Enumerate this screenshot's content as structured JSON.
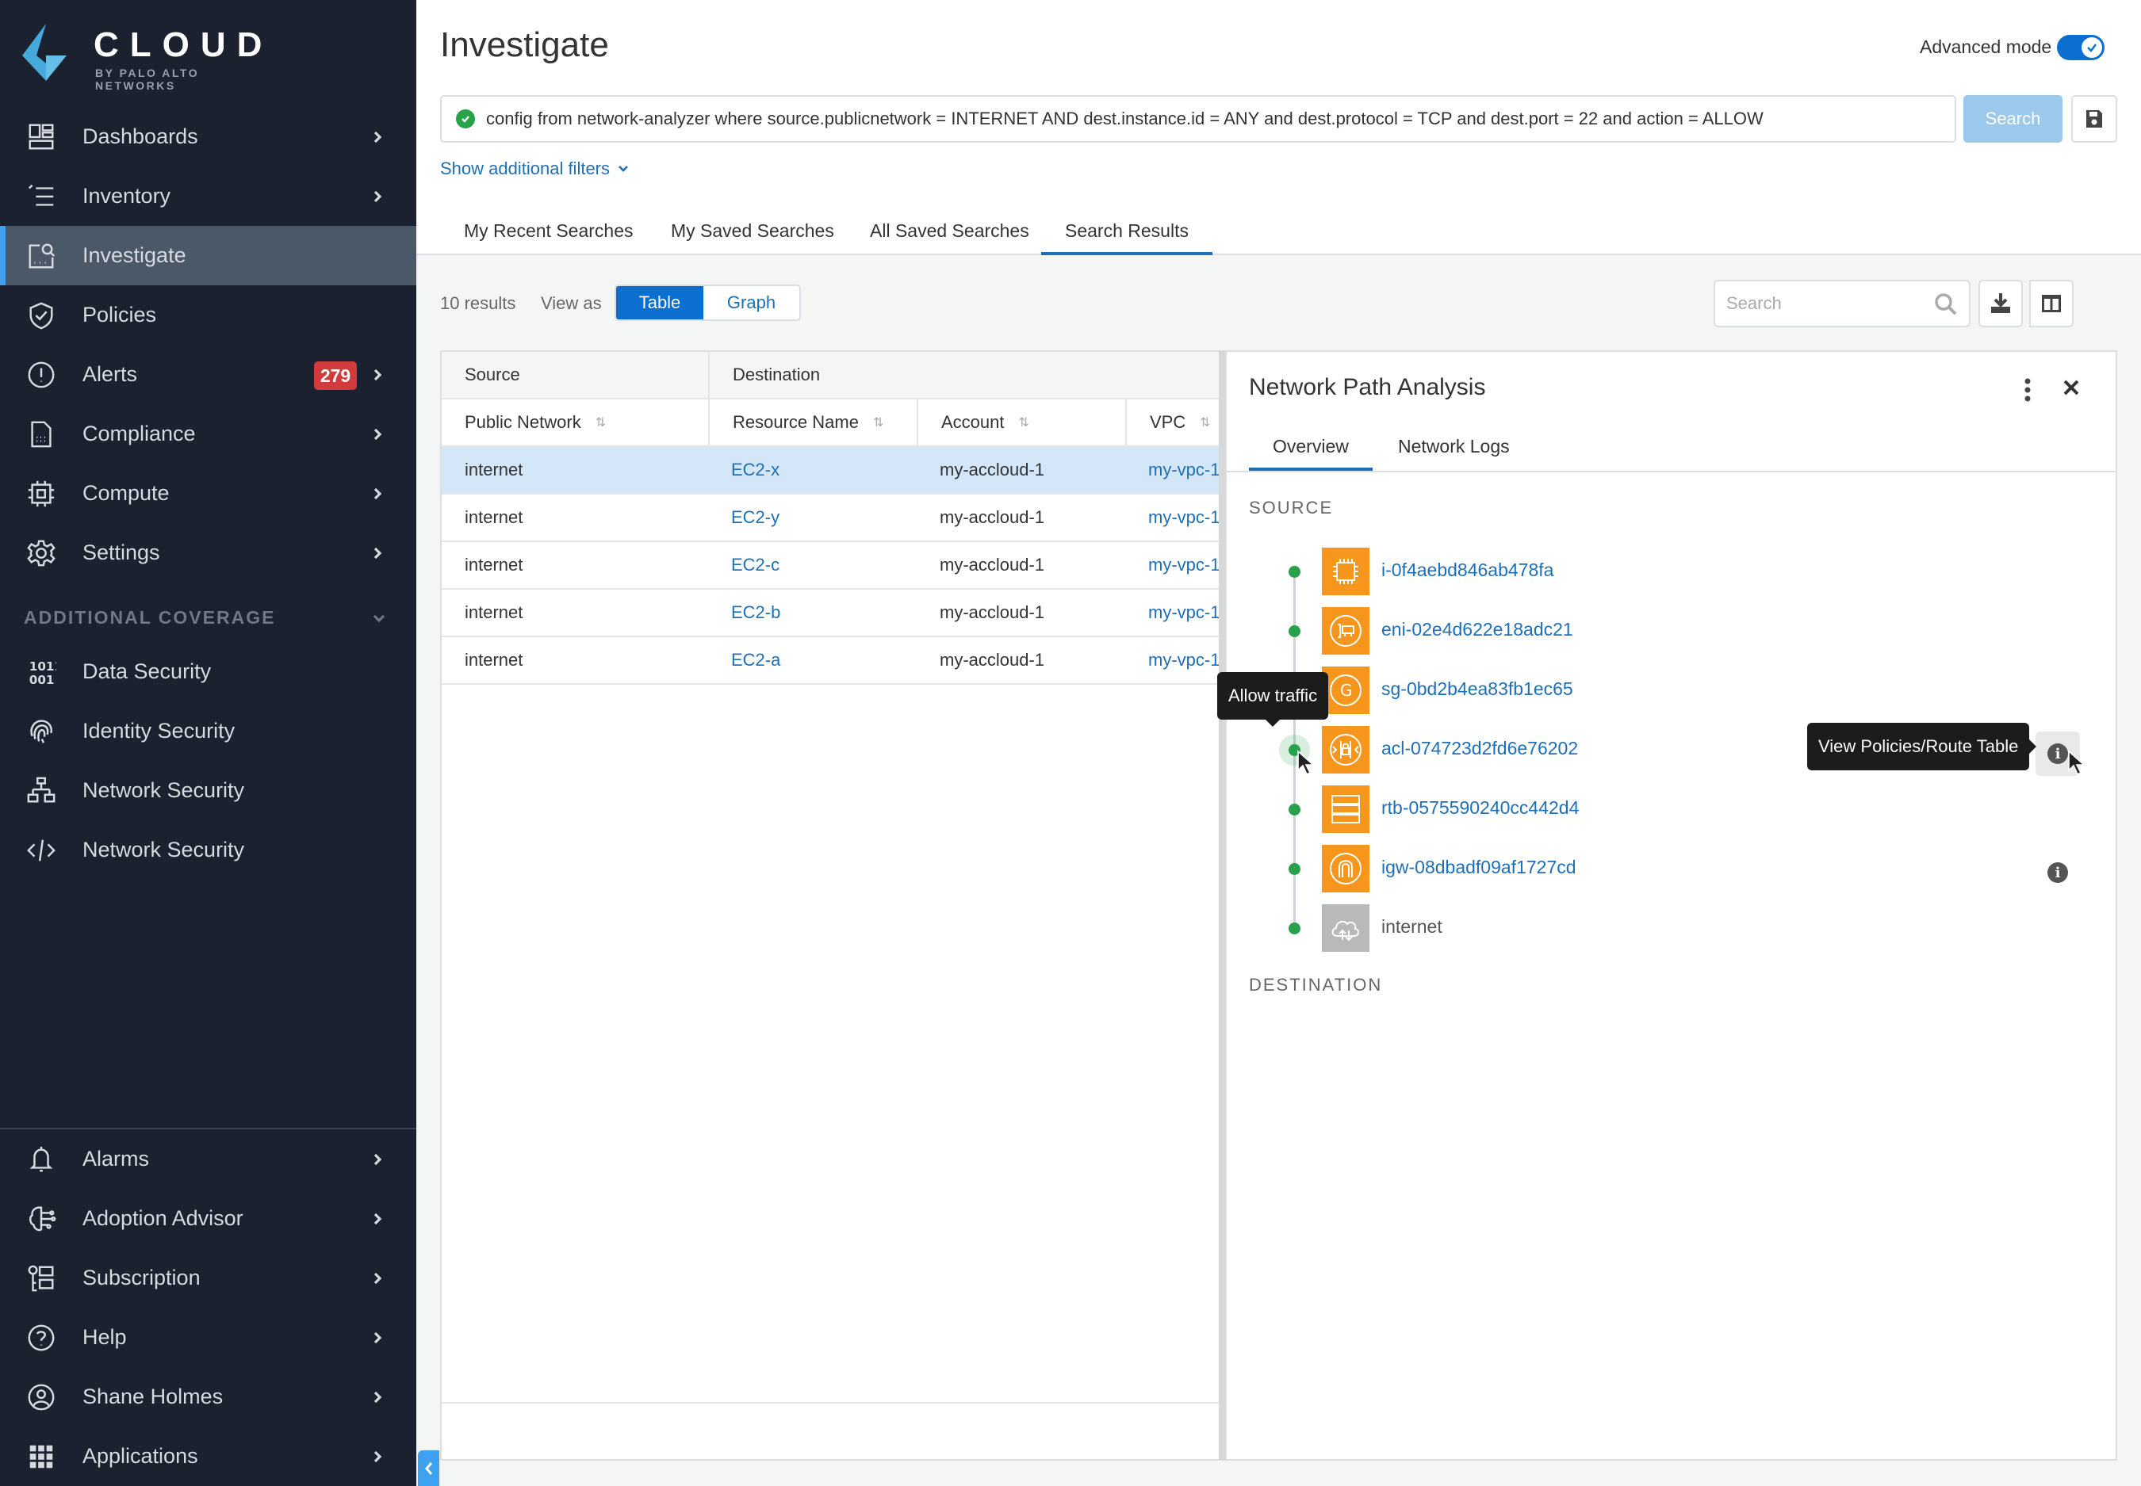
{
  "brand": {
    "name": "CLOUD",
    "tagline": "BY PALO ALTO NETWORKS",
    "accent": "#3ea2f0"
  },
  "sidebar": {
    "items": [
      {
        "label": "Dashboards",
        "icon": "dashboard-icon",
        "chevron": true
      },
      {
        "label": "Inventory",
        "icon": "inventory-list-icon",
        "chevron": true
      },
      {
        "label": "Investigate",
        "icon": "investigate-icon",
        "chevron": false,
        "active": true
      },
      {
        "label": "Policies",
        "icon": "shield-check-icon",
        "chevron": false
      },
      {
        "label": "Alerts",
        "icon": "alert-circle-icon",
        "chevron": true,
        "badge": "279"
      },
      {
        "label": "Compliance",
        "icon": "compliance-doc-icon",
        "chevron": true
      },
      {
        "label": "Compute",
        "icon": "chip-icon",
        "chevron": true
      },
      {
        "label": "Settings",
        "icon": "gear-icon",
        "chevron": true
      }
    ],
    "section_label": "ADDITIONAL COVERAGE",
    "coverage_items": [
      {
        "label": "Data Security",
        "icon": "binary-icon"
      },
      {
        "label": "Identity Security",
        "icon": "fingerprint-icon"
      },
      {
        "label": "Network Security",
        "icon": "network-icon"
      },
      {
        "label": "Network Security",
        "icon": "code-icon"
      }
    ],
    "bottom_items": [
      {
        "label": "Alarms",
        "icon": "bell-icon"
      },
      {
        "label": "Adoption Advisor",
        "icon": "brain-icon"
      },
      {
        "label": "Subscription",
        "icon": "subscription-icon"
      },
      {
        "label": "Help",
        "icon": "help-circle-icon"
      },
      {
        "label": "Shane Holmes",
        "icon": "user-circle-icon"
      },
      {
        "label": "Applications",
        "icon": "grid-icon"
      }
    ]
  },
  "header": {
    "title": "Investigate",
    "advanced_mode_label": "Advanced mode",
    "advanced_mode_on": true,
    "query": "config from network-analyzer where source.publicnetwork = INTERNET AND dest.instance.id = ANY and dest.protocol = TCP and dest.port = 22 and action = ALLOW",
    "search_label": "Search",
    "filters_link": "Show additional filters"
  },
  "tabs": [
    {
      "label": "My Recent Searches"
    },
    {
      "label": "My Saved Searches"
    },
    {
      "label": "All Saved Searches"
    },
    {
      "label": "Search Results",
      "active": true
    }
  ],
  "results": {
    "count_label": "10 results",
    "view_as_label": "View as",
    "views": [
      "Table",
      "Graph"
    ],
    "active_view": "Table",
    "search_placeholder": "Search"
  },
  "table": {
    "groups": [
      "Source",
      "Destination"
    ],
    "columns": [
      "Public Network",
      "Resource Name",
      "Account",
      "VPC"
    ],
    "rows": [
      {
        "public_network": "internet",
        "resource_name": "EC2-x",
        "account": "my-accloud-1",
        "vpc": "my-vpc-1",
        "selected": true
      },
      {
        "public_network": "internet",
        "resource_name": "EC2-y",
        "account": "my-accloud-1",
        "vpc": "my-vpc-1"
      },
      {
        "public_network": "internet",
        "resource_name": "EC2-c",
        "account": "my-accloud-1",
        "vpc": "my-vpc-1"
      },
      {
        "public_network": "internet",
        "resource_name": "EC2-b",
        "account": "my-accloud-1",
        "vpc": "my-vpc-1"
      },
      {
        "public_network": "internet",
        "resource_name": "EC2-a",
        "account": "my-accloud-1",
        "vpc": "my-vpc-1"
      }
    ]
  },
  "panel": {
    "title": "Network Path Analysis",
    "tabs": [
      {
        "label": "Overview",
        "active": true
      },
      {
        "label": "Network Logs"
      }
    ],
    "source_label": "SOURCE",
    "destination_label": "DESTINATION",
    "hops": [
      {
        "name": "i-0f4aebd846ab478fa",
        "icon": "ec2-instance-icon",
        "link": true
      },
      {
        "name": "eni-02e4d622e18adc21",
        "icon": "network-interface-icon",
        "link": true
      },
      {
        "name": "sg-0bd2b4ea83fb1ec65",
        "icon": "security-group-icon",
        "link": true
      },
      {
        "name": "acl-074723d2fd6e76202",
        "icon": "network-acl-icon",
        "link": true,
        "info": true
      },
      {
        "name": "rtb-0575590240cc442d4",
        "icon": "route-table-icon",
        "link": true
      },
      {
        "name": "igw-08dbadf09af1727cd",
        "icon": "internet-gateway-icon",
        "link": true,
        "info": true
      },
      {
        "name": "internet",
        "icon": "cloud-icon",
        "link": false
      }
    ],
    "tooltip_allow": "Allow traffic",
    "tooltip_policies": "View Policies/Route Table",
    "status_color": "#27a24a",
    "resource_tile_color": "#f7961c"
  }
}
